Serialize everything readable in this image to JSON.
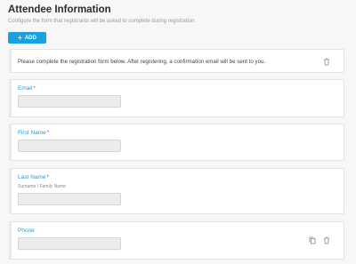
{
  "header": {
    "title": "Attendee Information",
    "subtitle": "Configure the form that registrants will be asked to complete during registration."
  },
  "toolbar": {
    "add_label": "ADD",
    "add_icon": "plus-icon"
  },
  "notice": {
    "text": "Please complete the registration form below. After registering, a confirmation email will be sent to you.",
    "actions": [
      "trash-icon"
    ]
  },
  "fields": [
    {
      "label": "Email",
      "required_mark": "*",
      "hint": "",
      "actions": []
    },
    {
      "label": "First Name",
      "required_mark": "*",
      "hint": "",
      "actions": []
    },
    {
      "label": "Last Name",
      "required_mark": "*",
      "hint": "Surname / Family Name",
      "actions": []
    },
    {
      "label": "Phone",
      "required_mark": "",
      "hint": "",
      "actions": [
        "copy-icon",
        "trash-icon"
      ]
    }
  ],
  "colors": {
    "accent": "#1a9fe0",
    "label": "#2c9ad6",
    "required": "#e03a3a"
  }
}
